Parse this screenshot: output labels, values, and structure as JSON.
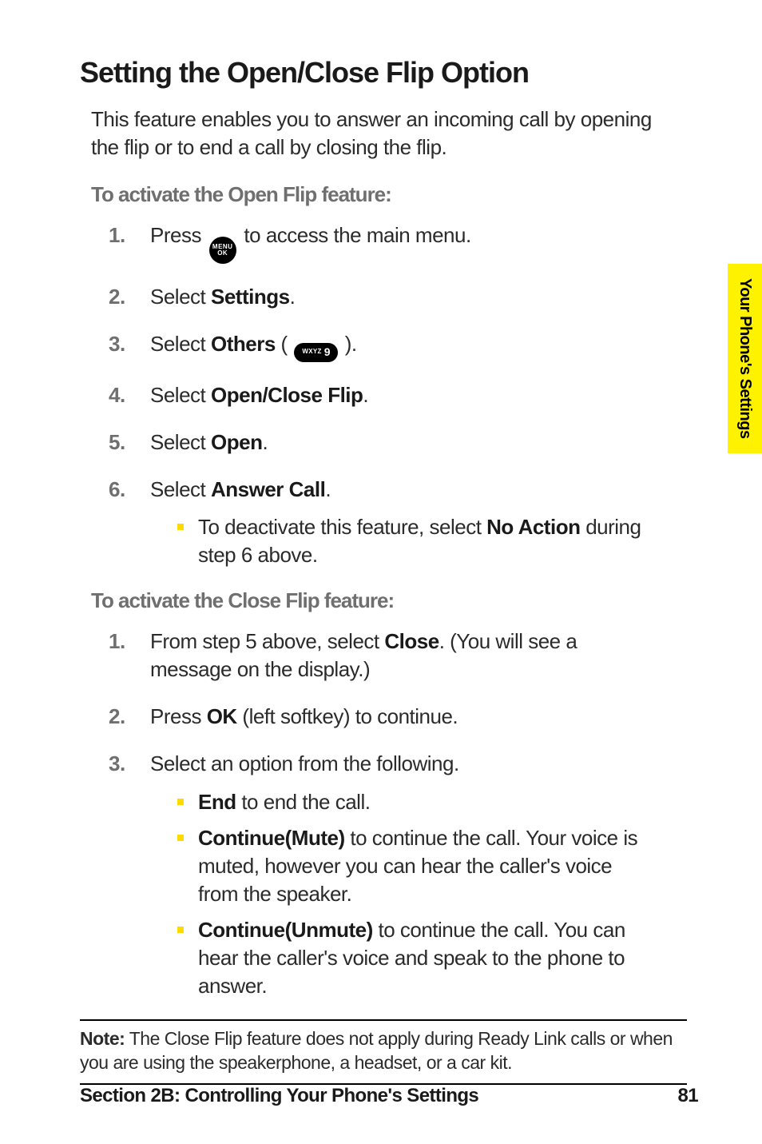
{
  "sideTab": "Your Phone's Settings",
  "title": "Setting the Open/Close Flip Option",
  "intro": "This feature enables you to answer an incoming call by opening the flip or to end a call by closing the flip.",
  "section1": {
    "heading": "To activate the Open Flip feature:",
    "steps": {
      "s1a": "Press ",
      "s1b": " to access the main menu.",
      "s2a": "Select ",
      "s2b": "Settings",
      "s2c": ".",
      "s3a": "Select ",
      "s3b": "Others",
      "s3c": " ( ",
      "s3d": " ).",
      "s4a": "Select ",
      "s4b": "Open/Close Flip",
      "s4c": ".",
      "s5a": "Select ",
      "s5b": "Open",
      "s5c": ".",
      "s6a": "Select ",
      "s6b": "Answer Call",
      "s6c": ".",
      "s6suba": "To deactivate this feature, select ",
      "s6subb": "No Action",
      "s6subc": " during step 6 above."
    }
  },
  "section2": {
    "heading": "To activate the Close Flip feature:",
    "steps": {
      "s1a": "From step 5 above, select ",
      "s1b": "Close",
      "s1c": ". (You will see a message on the display.)",
      "s2a": "Press ",
      "s2b": "OK",
      "s2c": " (left softkey) to continue.",
      "s3a": "Select an option from the following.",
      "s3b1a": "End",
      "s3b1b": " to end the call.",
      "s3b2a": "Continue(Mute)",
      "s3b2b": " to continue the call. Your voice is muted, however you can hear the caller's voice from the speaker.",
      "s3b3a": "Continue(Unmute)",
      "s3b3b": " to continue the call. You can hear the caller's voice and speak to the phone to answer."
    }
  },
  "note": {
    "label": "Note:",
    "text": " The Close Flip feature does not apply during Ready Link calls or when you are using the speakerphone, a headset, or a car kit."
  },
  "footer": {
    "section": "Section 2B: Controlling Your Phone's Settings",
    "page": "81"
  },
  "iconText": {
    "menuTop": "MENU",
    "menuBottom": "OK",
    "wxyz": "WXYZ",
    "nine": "9"
  }
}
